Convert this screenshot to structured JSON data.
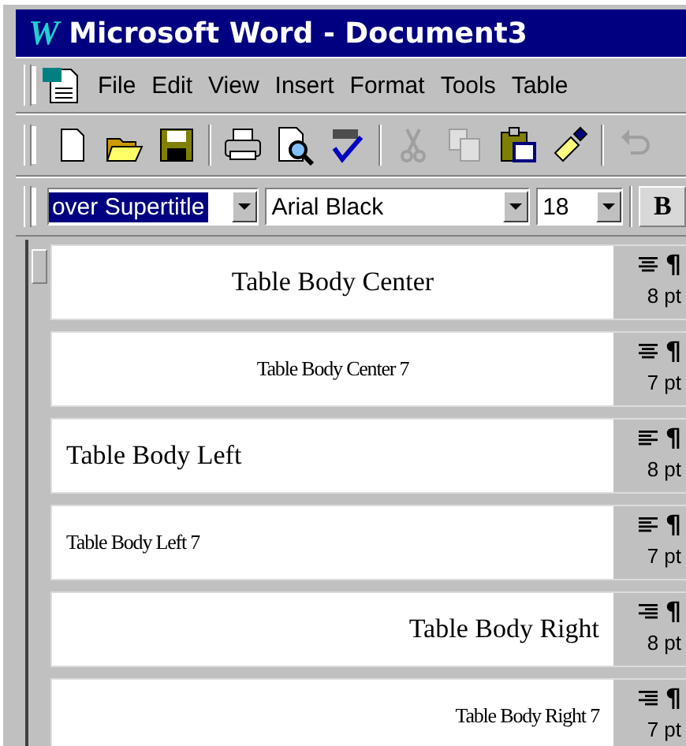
{
  "window": {
    "logo": "W",
    "title": "Microsoft Word - Document3"
  },
  "menu": [
    {
      "label": "File"
    },
    {
      "label": "Edit"
    },
    {
      "label": "View"
    },
    {
      "label": "Insert"
    },
    {
      "label": "Format"
    },
    {
      "label": "Tools"
    },
    {
      "label": "Table"
    }
  ],
  "toolbar": [
    {
      "kind": "new",
      "disabled": false
    },
    {
      "kind": "open",
      "disabled": false
    },
    {
      "kind": "save",
      "disabled": false
    },
    {
      "kind": "sep"
    },
    {
      "kind": "print",
      "disabled": false
    },
    {
      "kind": "preview",
      "disabled": false
    },
    {
      "kind": "spell",
      "disabled": false
    },
    {
      "kind": "sep"
    },
    {
      "kind": "cut",
      "disabled": true
    },
    {
      "kind": "copy",
      "disabled": true
    },
    {
      "kind": "paste",
      "disabled": false
    },
    {
      "kind": "painter",
      "disabled": false
    },
    {
      "kind": "sep"
    },
    {
      "kind": "undo",
      "disabled": true
    }
  ],
  "format_bar": {
    "style": {
      "value": "over Supertitle",
      "selected": true
    },
    "font": {
      "value": "Arial Black"
    },
    "size": {
      "value": "18"
    },
    "bold": {
      "label": "B"
    }
  },
  "styles": [
    {
      "name": "Table Body Center",
      "kind": "center",
      "condensed": false,
      "size": "8 pt",
      "mark": "¶"
    },
    {
      "name": "Table Body Center 7",
      "kind": "center",
      "condensed": true,
      "size": "7 pt",
      "mark": "¶"
    },
    {
      "name": "Table Body Left",
      "kind": "left",
      "condensed": false,
      "size": "8 pt",
      "mark": "¶"
    },
    {
      "name": "Table Body Left 7",
      "kind": "left",
      "condensed": true,
      "size": "7 pt",
      "mark": "¶"
    },
    {
      "name": "Table Body Right",
      "kind": "right",
      "condensed": false,
      "size": "8 pt",
      "mark": "¶"
    },
    {
      "name": "Table Body Right 7",
      "kind": "right",
      "condensed": true,
      "size": "7 pt",
      "mark": "¶"
    }
  ]
}
